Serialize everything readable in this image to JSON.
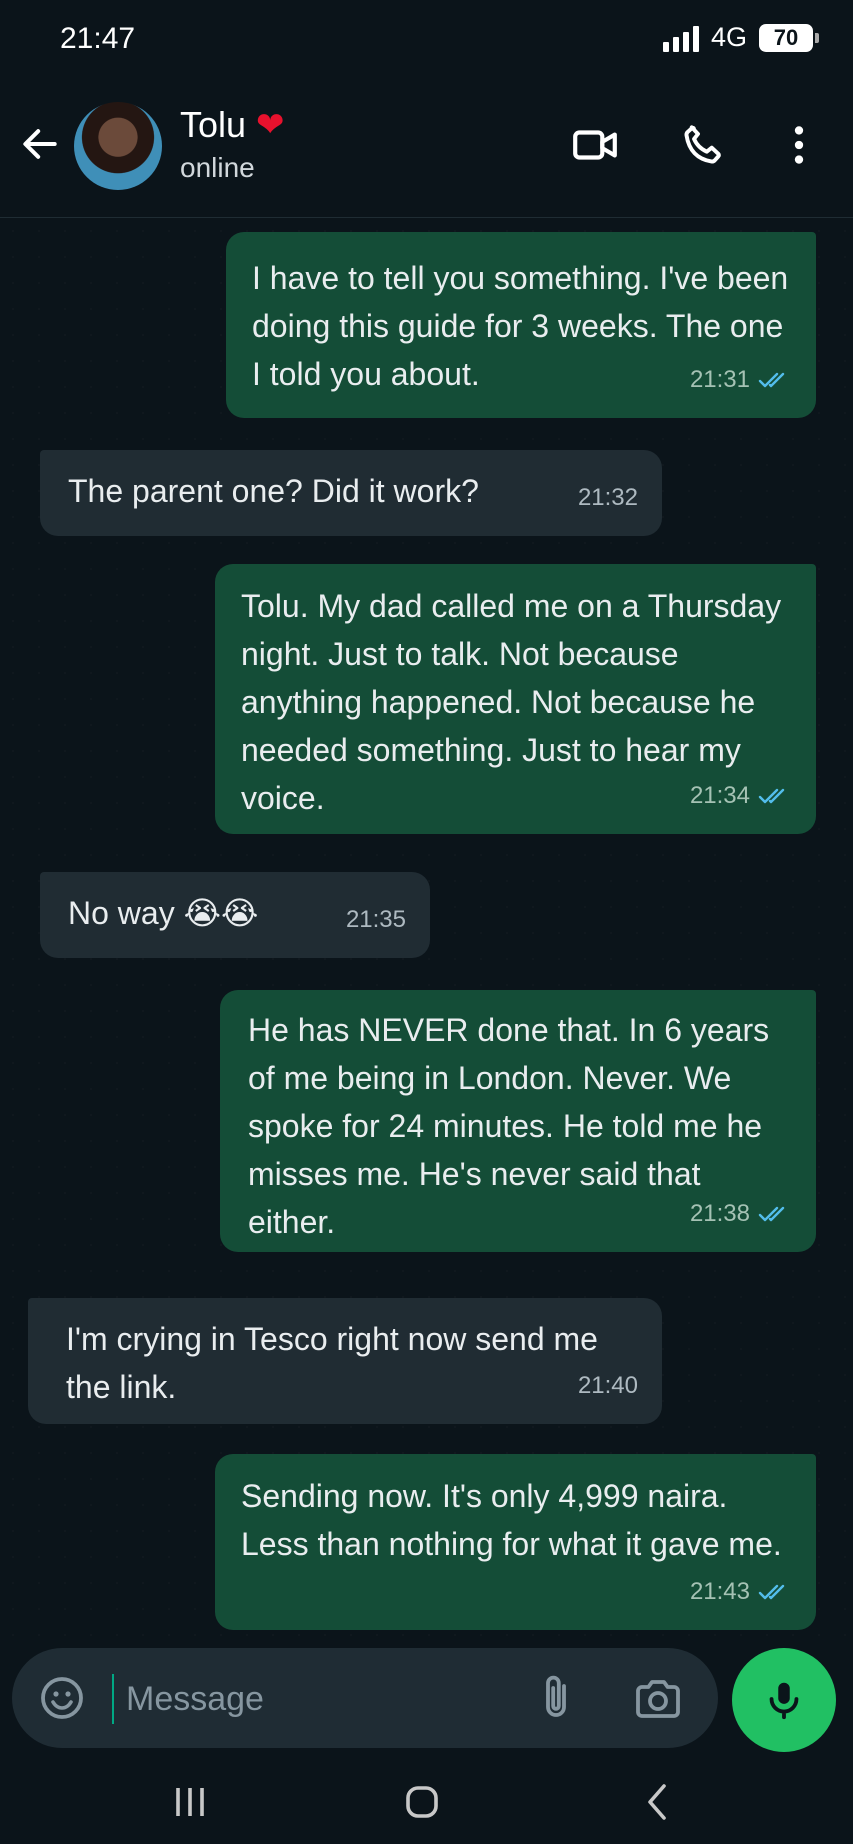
{
  "status_bar": {
    "time": "21:47",
    "network": "4G",
    "battery": "70"
  },
  "header": {
    "contact_name": "Tolu",
    "heart": "❤",
    "status": "online"
  },
  "messages": [
    {
      "direction": "outgoing",
      "text": "I have to tell you something. I've been doing this guide for 3 weeks. The one I told you about.",
      "time": "21:31",
      "read": true
    },
    {
      "direction": "incoming",
      "text": "The parent one? Did it work?",
      "time": "21:32"
    },
    {
      "direction": "outgoing",
      "text": "Tolu. My dad called me on a Thursday night. Just to talk. Not because anything happened. Not because he needed something. Just to hear my voice.",
      "time": "21:34",
      "read": true
    },
    {
      "direction": "incoming",
      "text": "No way 😭😭",
      "time": "21:35"
    },
    {
      "direction": "outgoing",
      "text": "He has NEVER done that. In 6 years of me being in London. Never. We spoke for 24 minutes. He told me he misses me. He's never said that either.",
      "time": "21:38",
      "read": true
    },
    {
      "direction": "incoming",
      "text": "I'm crying in Tesco right now send me the link.",
      "time": "21:40"
    },
    {
      "direction": "outgoing",
      "text": "Sending now. It's only 4,999 naira. Less than nothing for what it gave me.",
      "time": "21:43",
      "read": true
    }
  ],
  "composer": {
    "placeholder": "Message"
  },
  "colors": {
    "outgoing_bubble": "#144d37",
    "incoming_bubble": "#202c33",
    "mic_button": "#21c063",
    "read_ticks": "#53bdeb"
  }
}
